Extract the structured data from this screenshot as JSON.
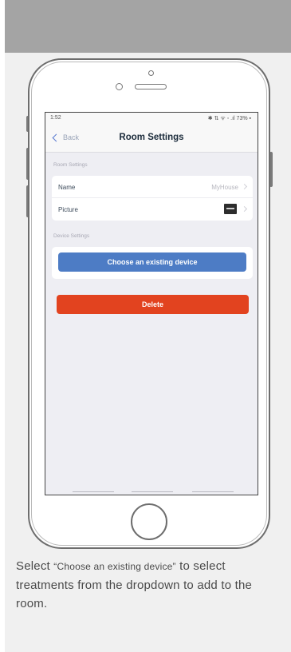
{
  "status_bar": {
    "time": "1:52",
    "icons_text": "✱ ⇅ ᯤ ◦ .ıl 73% ▪"
  },
  "nav": {
    "back_label": "Back",
    "title": "Room Settings"
  },
  "room_settings": {
    "section_label": "Room Settings",
    "rows": [
      {
        "label": "Name",
        "value": "MyHouse"
      },
      {
        "label": "Picture",
        "value": ""
      }
    ]
  },
  "device_settings": {
    "section_label": "Device Settings",
    "choose_button": "Choose an existing device"
  },
  "actions": {
    "delete_button": "Delete"
  },
  "caption": {
    "prefix": "Select ",
    "quoted": "“Choose an existing device”",
    "suffix": " to select treatments from the dropdown to add to the room."
  },
  "colors": {
    "choose_button": "#4d7cc5",
    "delete_button": "#e2431f",
    "top_band": "#a4a4a4"
  }
}
